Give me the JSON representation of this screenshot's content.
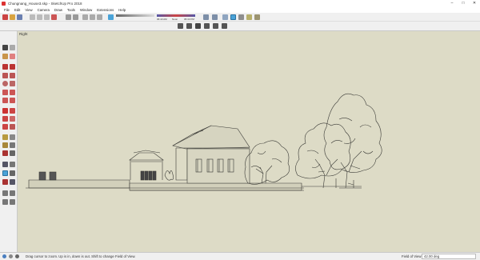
{
  "window": {
    "title": "Chungnang_House3.skp - SketchUp Pro 2018",
    "controls": [
      "–",
      "□",
      "✕"
    ]
  },
  "menu": [
    "File",
    "Edit",
    "View",
    "Camera",
    "Draw",
    "Tools",
    "Window",
    "Extensions",
    "Help"
  ],
  "toolbar": {
    "shadow_time_left": "06:43 AM",
    "shadow_time_mid": "Noon",
    "shadow_time_right": "05:33 PM"
  },
  "viewport": {
    "view_name": "Right"
  },
  "status": {
    "hint": "Drag cursor to zoom.  Up is in, down is out. Shift to change Field of View.",
    "measure_label": "Field of View",
    "measure_value": "42.00 deg"
  },
  "colors": {
    "viewport_bg": "#dddbc6",
    "ui_bg": "#f0f0f0",
    "line": "#3a3a36"
  }
}
